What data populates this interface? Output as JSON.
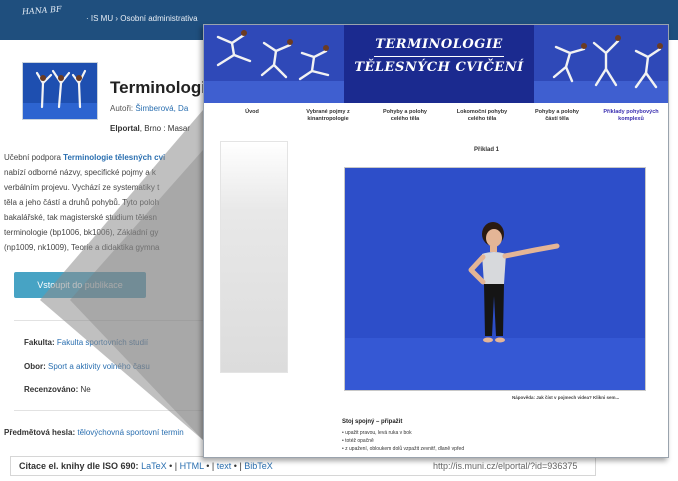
{
  "topbar": {
    "logo_text": "HANA BF",
    "breadcrumb": "· IS MU › Osobní administrativa"
  },
  "publication": {
    "title": "Terminologie",
    "authors_label": "Autoři:",
    "authors": "Šimberová, Da",
    "publisher_bold": "Elportal",
    "publisher_rest": ", Brno : Masar",
    "enter_button": "Vstoupit do publikace"
  },
  "description": {
    "line1_prefix": "Učební podpora ",
    "line1_link": "Terminologie tělesných cvi",
    "line2": "nabízí odborné názvy, specifické pojmy a k",
    "line3": "verbálním projevu. Vychází ze systematiky t",
    "line4": "těla a jeho částí a druhů pohybů. Tyto poloh",
    "line5": "bakalářské, tak magisterské studium tělesn",
    "line6": "terminologie (bp1006, bk1006), Základní gy",
    "line7": "(np1009, nk1009), Teorie a didaktika gymna"
  },
  "meta": {
    "faculty_label": "Fakulta:",
    "faculty_value": "Fakulta sportovních studií",
    "field_label": "Obor:",
    "field_value": "Sport a aktivity volného času",
    "reviewed_label": "Recenzováno:",
    "reviewed_value": "Ne",
    "keywords_label": "Předmětová hesla:",
    "keywords_value": "tělovýchovná sportovní termin"
  },
  "citation": {
    "label": "Citace el. knihy dle ISO 690:",
    "latex": "LaTeX",
    "html": "HTML",
    "text": "text",
    "bibtex": "BibTeX",
    "sep": " • | ",
    "url": "http://is.muni.cz/elportal/?id=936375"
  },
  "screenshot": {
    "banner_line1": "TERMINOLOGIE",
    "banner_line2": "TĚLESNÝCH CVIČENÍ",
    "nav": [
      {
        "l1": "Úvod",
        "l2": ""
      },
      {
        "l1": "Vybrané pojmy z",
        "l2": "kinantropologie"
      },
      {
        "l1": "Pohyby a polohy",
        "l2": "celého těla"
      },
      {
        "l1": "Lokomoční pohyby",
        "l2": "celého těla"
      },
      {
        "l1": "Pohyby a polohy",
        "l2": "částí těla"
      },
      {
        "l1": "Příklady pohybových",
        "l2": "komplexů"
      }
    ],
    "example_title": "Příklad 1",
    "hint": "Nápověda: Jak číst v pojmech videa? Klikni sem...",
    "example_heading": "Stoj spojný – připažit",
    "example_items": [
      "• upažit pravou, levá ruka v bok",
      "• totéž opačně",
      "• z upažení, obloukem dolů vzpažit zevnitř, dlaně vpřed"
    ]
  },
  "colors": {
    "topbar": "#1f4f7e",
    "link": "#2a6fb0",
    "button": "#47a3c4",
    "banner": "#1b2a8f",
    "photo_bg": "#2d4ec9"
  }
}
